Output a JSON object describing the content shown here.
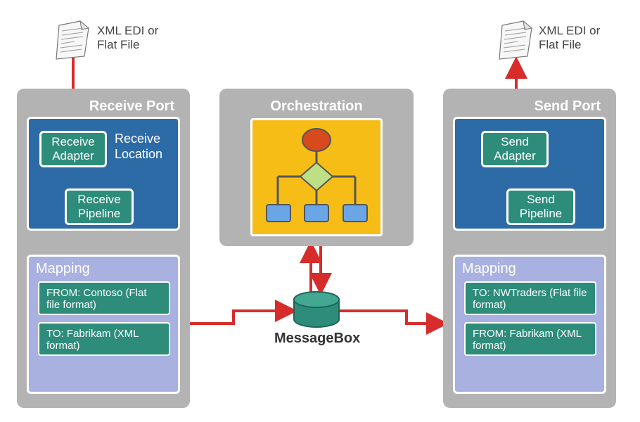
{
  "doc_left_label": "XML EDI or Flat File",
  "doc_right_label": "XML EDI or Flat File",
  "receive_port": {
    "title": "Receive Port",
    "location_label": "Receive Location",
    "adapter": "Receive Adapter",
    "pipeline": "Receive Pipeline"
  },
  "orchestration": {
    "title": "Orchestration"
  },
  "send_port": {
    "title": "Send Port",
    "adapter": "Send Adapter",
    "pipeline": "Send Pipeline"
  },
  "mapping_left": {
    "title": "Mapping",
    "from": "FROM: Contoso (Flat file format)",
    "to": "TO: Fabrikam (XML format)"
  },
  "mapping_right": {
    "title": "Mapping",
    "to": "TO: NWTraders (Flat file format)",
    "from": "FROM: Fabrikam (XML format)"
  },
  "messagebox_label": "MessageBox",
  "colors": {
    "panel": "#b3b3b3",
    "location": "#2c6ba6",
    "component": "#2d8c7a",
    "mapping_bg": "#a8b1e0",
    "orch": "#f6bd16",
    "arrow": "#d62c2c"
  }
}
